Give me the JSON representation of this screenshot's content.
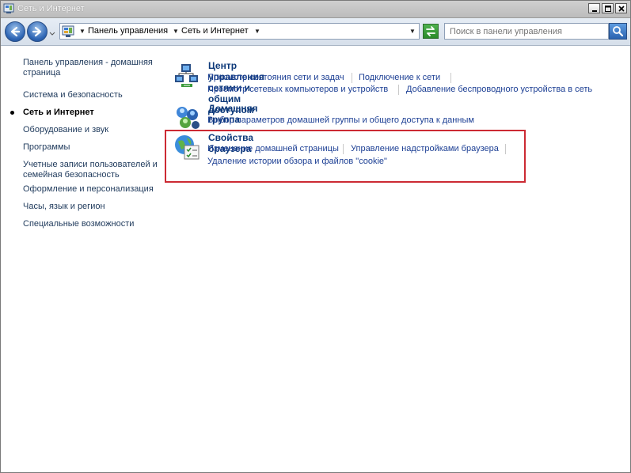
{
  "window": {
    "title": "Сеть и Интернет"
  },
  "address_bar": {
    "crumbs": [
      "Панель управления",
      "Сеть и Интернет"
    ]
  },
  "search": {
    "placeholder": "Поиск в панели управления"
  },
  "sidebar": {
    "items": [
      {
        "label": "Панель управления - домашняя страница",
        "current": false
      },
      {
        "label": "Система и безопасность",
        "current": false
      },
      {
        "label": "Сеть и Интернет",
        "current": true
      },
      {
        "label": "Оборудование и звук",
        "current": false
      },
      {
        "label": "Программы",
        "current": false
      },
      {
        "label": "Учетные записи пользователей и семейная безопасность",
        "current": false
      },
      {
        "label": "Оформление и персонализация",
        "current": false
      },
      {
        "label": "Часы, язык и регион",
        "current": false
      },
      {
        "label": "Специальные возможности",
        "current": false
      }
    ]
  },
  "categories": [
    {
      "title": "Центр управления сетями и общим доступом",
      "icon": "network-center-icon",
      "links": [
        "Просмотр состояния сети и задач",
        "Подключение к сети",
        "Просмотр сетевых компьютеров и устройств",
        "Добавление беспроводного устройства в сеть"
      ]
    },
    {
      "title": "Домашняя группа",
      "icon": "homegroup-icon",
      "links": [
        "Выбор параметров домашней группы и общего доступа к данным"
      ]
    },
    {
      "title": "Свойства браузера",
      "icon": "internet-options-icon",
      "links": [
        "Изменение домашней страницы",
        "Управление надстройками браузера",
        "Удаление истории обзора и файлов \"cookie\""
      ]
    }
  ],
  "colors": {
    "highlight_border": "#cc2a33",
    "link": "#1c3f94",
    "title": "#0e3a7a"
  }
}
